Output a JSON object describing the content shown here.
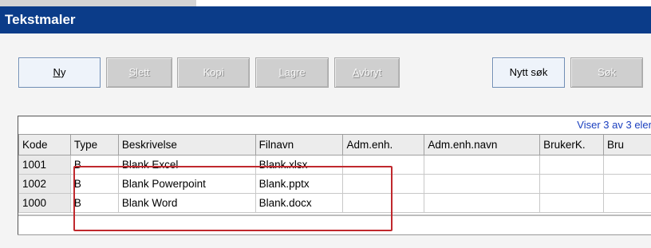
{
  "window": {
    "title": "Tekstmaler"
  },
  "toolbar": {
    "buttons": [
      {
        "label": "Ny",
        "mnemonic": "N",
        "rest": "y",
        "enabled": true
      },
      {
        "label": "Slett",
        "mnemonic": "S",
        "rest": "lett",
        "enabled": false
      },
      {
        "label": "Kopi",
        "mnemonic": "",
        "rest": "Kopi",
        "enabled": false
      },
      {
        "label": "Lagre",
        "mnemonic": "L",
        "rest": "agre",
        "enabled": false
      },
      {
        "label": "Avbryt",
        "mnemonic": "A",
        "rest": "vbryt",
        "enabled": false
      },
      {
        "label": "Nytt søk",
        "enabled": true
      },
      {
        "label": "Søk",
        "enabled": false
      }
    ]
  },
  "grid": {
    "status": "Viser 3 av 3 eler",
    "columns": [
      "Kode",
      "Type",
      "Beskrivelse",
      "Filnavn",
      "Adm.enh.",
      "Adm.enh.navn",
      "BrukerK.",
      "Bru"
    ],
    "rows": [
      [
        "1001",
        "B",
        "Blank Excel",
        "Blank.xlsx",
        "",
        "",
        "",
        ""
      ],
      [
        "1002",
        "B",
        "Blank Powerpoint",
        "Blank.pptx",
        "",
        "",
        "",
        ""
      ],
      [
        "1000",
        "B",
        "Blank Word",
        "Blank.docx",
        "",
        "",
        "",
        ""
      ]
    ]
  },
  "colors": {
    "titlebar": "#0b3c89",
    "status_text": "#1a3fbf",
    "highlight": "#c0282d"
  }
}
